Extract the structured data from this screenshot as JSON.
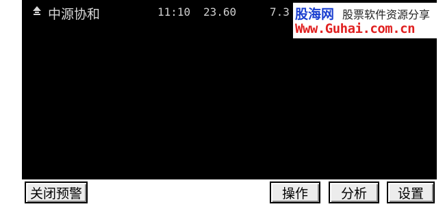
{
  "alerts": {
    "rows": [
      {
        "icon": "up-arrow-icon",
        "name": "中源协和",
        "time": "11:10",
        "price": "23.60",
        "change_pct": "7.3"
      }
    ]
  },
  "toolbar": {
    "close_label": "关闭预警",
    "operate_label": "操作",
    "analyze_label": "分析",
    "settings_label": "设置"
  },
  "watermark": {
    "logo": "股海网",
    "tagline": "股票软件资源分享",
    "url": "Www.Guhai.com.cn"
  },
  "colors": {
    "window_bg": "#000000",
    "row_text": "#d8d8d8",
    "logo_blue": "#1a3fd0",
    "url_red": "#e02020"
  }
}
